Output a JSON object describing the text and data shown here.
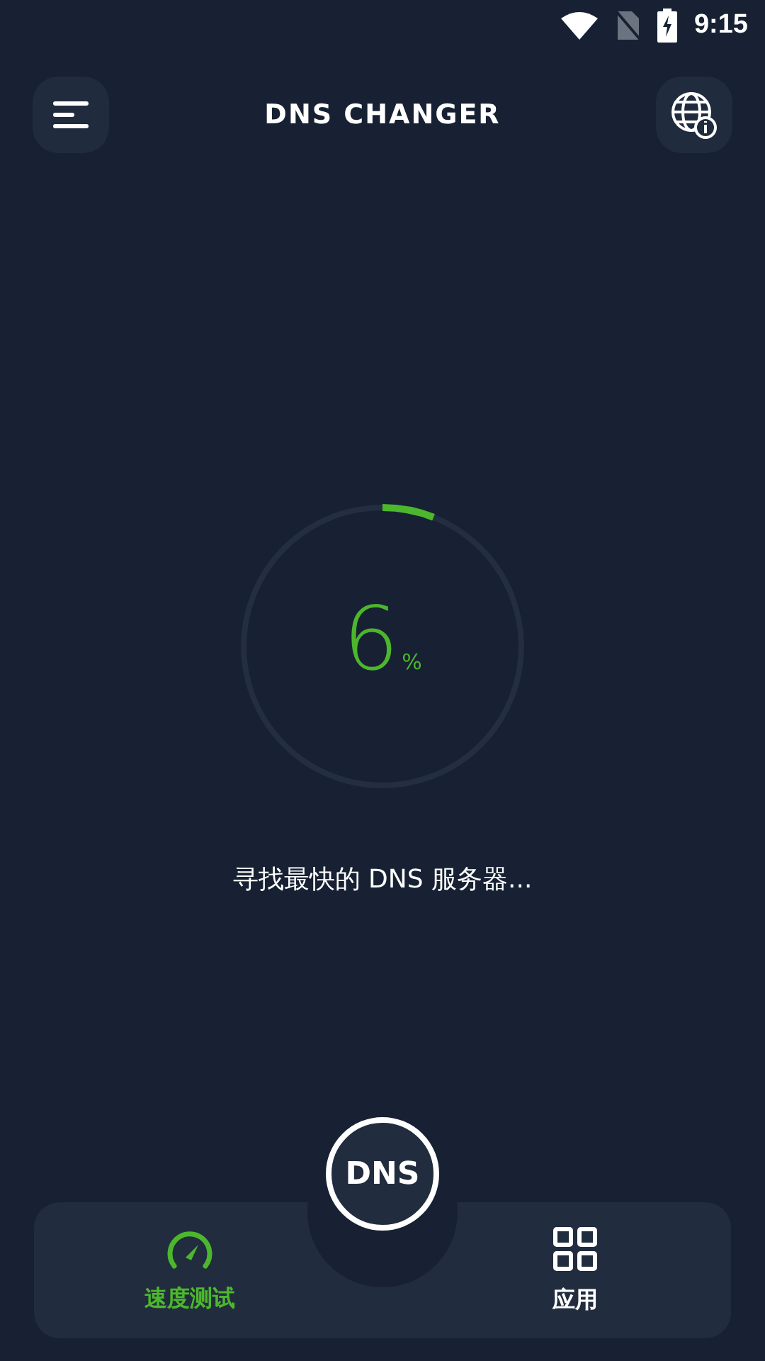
{
  "status_bar": {
    "time": "9:15"
  },
  "header": {
    "title": "DNS CHANGER"
  },
  "progress": {
    "value": "6",
    "unit": "%",
    "level": 0.06
  },
  "status_text": "寻找最快的 DNS 服务器...",
  "center_button": {
    "label": "DNS"
  },
  "nav": [
    {
      "kind": "speed",
      "label": "速度测试",
      "selected": true
    },
    {
      "kind": "apps",
      "label": "应用",
      "selected": false
    }
  ]
}
